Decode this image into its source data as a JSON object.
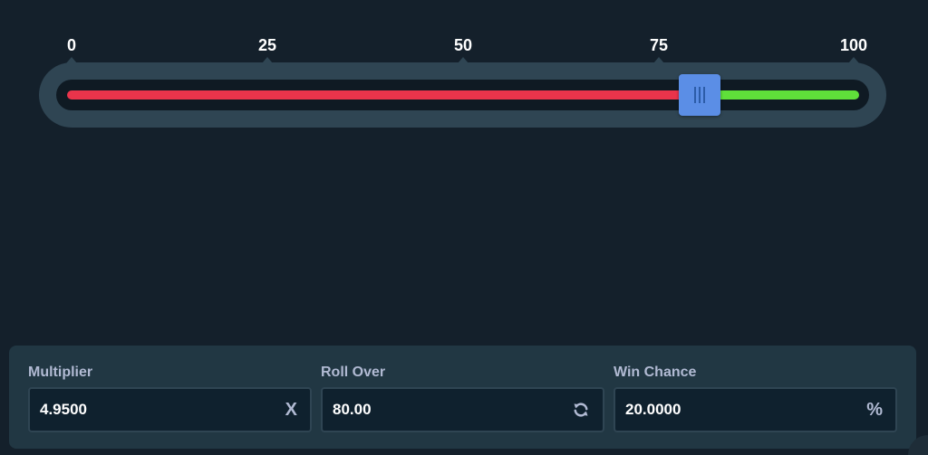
{
  "slider": {
    "ticks": [
      "0",
      "25",
      "50",
      "75",
      "100"
    ],
    "value": 80,
    "min": 0,
    "max": 100,
    "lose_color": "#e9344b",
    "win_color": "#5fe03a",
    "handle_color": "#5b8ee6",
    "handle_icon": "grip-lines-icon"
  },
  "controls": {
    "multiplier": {
      "label": "Multiplier",
      "value": "4.9500",
      "suffix": "X"
    },
    "roll_over": {
      "label": "Roll Over",
      "value": "80.00",
      "suffix_icon": "refresh-icon"
    },
    "win_chance": {
      "label": "Win Chance",
      "value": "20.0000",
      "suffix": "%"
    }
  }
}
